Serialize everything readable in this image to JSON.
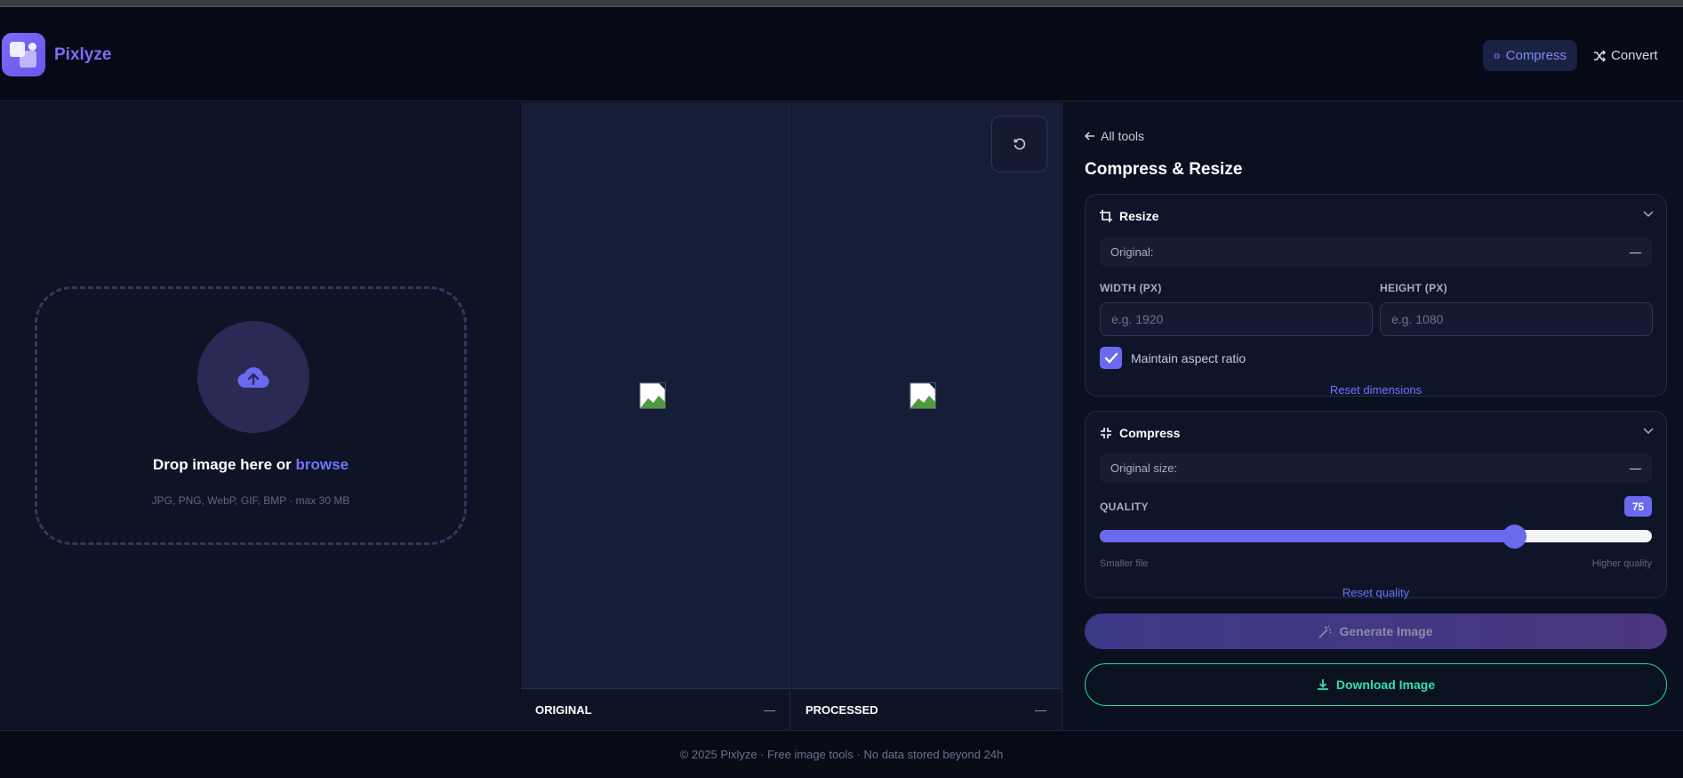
{
  "header": {
    "brand": "Pixlyze",
    "nav": [
      {
        "label": "Compress",
        "active": true
      },
      {
        "label": "Convert",
        "active": false
      }
    ]
  },
  "upload": {
    "title_prefix": "Drop image here or ",
    "title_link": "browse",
    "subtitle": "JPG, PNG, WebP, GIF, BMP · max 30 MB"
  },
  "preview": {
    "original_label": "ORIGINAL",
    "original_value": "—",
    "processed_label": "PROCESSED",
    "processed_value": "—"
  },
  "panel": {
    "back_label": "All tools",
    "title": "Compress & Resize",
    "resize": {
      "title": "Resize",
      "original_label": "Original:",
      "original_value": "—",
      "width_label": "WIDTH (PX)",
      "width_placeholder": "e.g. 1920",
      "height_label": "HEIGHT (PX)",
      "height_placeholder": "e.g. 1080",
      "aspect_label": "Maintain aspect ratio",
      "aspect_checked": true,
      "reset_label": "Reset dimensions"
    },
    "compress": {
      "title": "Compress",
      "original_size_label": "Original size:",
      "original_size_value": "—",
      "quality_label": "QUALITY",
      "quality_value": "75",
      "quality_fraction": 0.75,
      "min_label": "Smaller file",
      "max_label": "Higher quality",
      "reset_label": "Reset quality"
    },
    "generate_label": "Generate Image",
    "download_label": "Download Image"
  },
  "footer": {
    "text": "© 2025 Pixlyze · Free image tools · No data stored beyond 24h"
  },
  "colors": {
    "accent": "#6a6af0",
    "download": "#34e0ad",
    "background": "#0b1020"
  }
}
